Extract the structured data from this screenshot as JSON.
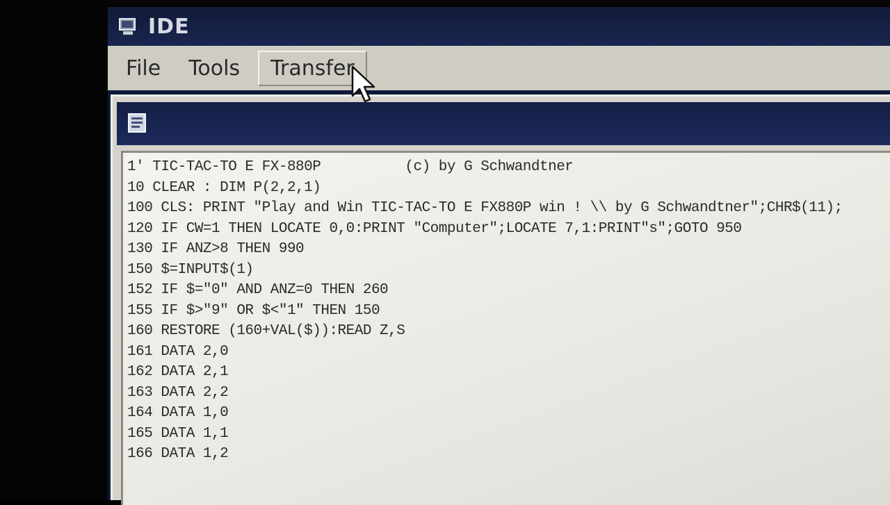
{
  "app": {
    "title": "IDE"
  },
  "menu": {
    "items": [
      {
        "label": "File"
      },
      {
        "label": "Tools"
      },
      {
        "label": "Transfer"
      }
    ]
  },
  "editor": {
    "lines": [
      "1' TIC-TAC-TO E FX-880P          (c) by G Schwandtner",
      "10 CLEAR : DIM P(2,2,1)",
      "100 CLS: PRINT \"Play and Win TIC-TAC-TO E FX880P win ! \\\\ by G Schwandtner\";CHR$(11);",
      "120 IF CW=1 THEN LOCATE 0,0:PRINT \"Computer\";LOCATE 7,1:PRINT\"s\";GOTO 950",
      "130 IF ANZ>8 THEN 990",
      "150 $=INPUT$(1)",
      "152 IF $=\"0\" AND ANZ=0 THEN 260",
      "155 IF $>\"9\" OR $<\"1\" THEN 150",
      "160 RESTORE (160+VAL($)):READ Z,S",
      "161 DATA 2,0",
      "162 DATA 2,1",
      "163 DATA 2,2",
      "164 DATA 1,0",
      "165 DATA 1,1",
      "166 DATA 1,2"
    ]
  },
  "icons": {
    "app_icon": "computer-app-icon",
    "window_icon": "document-window-icon",
    "cursor": "mouse-pointer-icon"
  },
  "colors": {
    "titlebar": "#1a2650",
    "menubar": "#cfccc4",
    "editor_bg": "#f4f3ef",
    "text": "#2b2b2b"
  }
}
